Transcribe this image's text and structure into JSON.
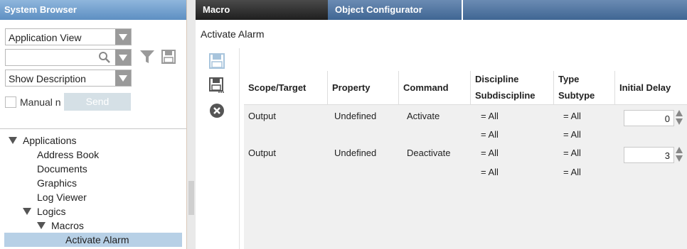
{
  "left_panel": {
    "title": "System Browser",
    "view_select": "Application View",
    "search_value": "",
    "description_select": "Show Description",
    "manual_label": "Manual n",
    "send_label": "Send"
  },
  "tree": [
    {
      "label": "Applications",
      "expanded": true
    },
    {
      "label": "Address Book"
    },
    {
      "label": "Documents"
    },
    {
      "label": "Graphics"
    },
    {
      "label": "Log Viewer"
    },
    {
      "label": "Logics",
      "expanded": true
    },
    {
      "label": "Macros",
      "expanded": true
    },
    {
      "label": "Activate Alarm",
      "selected": true
    }
  ],
  "tabs": {
    "macro": "Macro",
    "object_configurator": "Object Configurator"
  },
  "page_title": "Activate Alarm",
  "grid": {
    "headers": {
      "scope": "Scope/Target",
      "property": "Property",
      "command": "Command",
      "discipline": "Discipline",
      "subdiscipline": "Subdiscipline",
      "type": "Type",
      "subtype": "Subtype",
      "initial_delay": "Initial Delay"
    },
    "rows": [
      {
        "scope": "Output",
        "property": "Undefined",
        "command": "Activate",
        "discipline": "=  All",
        "subdiscipline": "=  All",
        "type": "=  All",
        "subtype": "=  All",
        "delay": "0"
      },
      {
        "scope": "Output",
        "property": "Undefined",
        "command": "Deactivate",
        "discipline": "=  All",
        "subdiscipline": "=  All",
        "type": "=  All",
        "subtype": "=  All",
        "delay": "3"
      }
    ]
  },
  "colors": {
    "header_blue": "#5d8fc2",
    "selected_row": "#b7d0e6",
    "macro_tab": "#2a2a2a"
  }
}
